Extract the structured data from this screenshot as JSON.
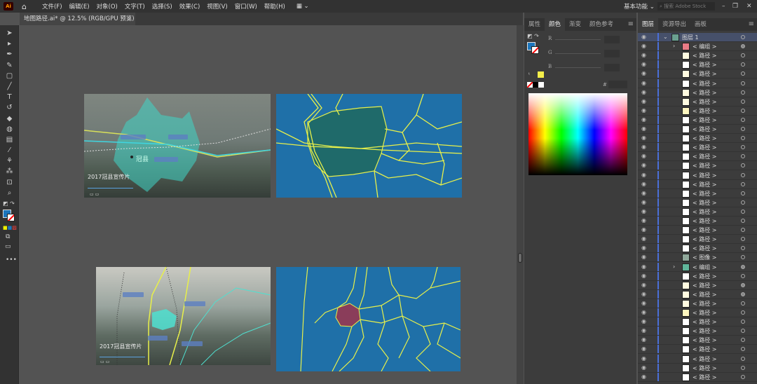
{
  "app": {
    "logo": "Ai",
    "home_icon": "home-icon"
  },
  "menu": [
    "文件(F)",
    "编辑(E)",
    "对象(O)",
    "文字(T)",
    "选择(S)",
    "效果(C)",
    "视图(V)",
    "窗口(W)",
    "帮助(H)"
  ],
  "workspace": {
    "label": "基本功能",
    "search_placeholder": "搜索 Adobe Stock"
  },
  "document_tab": {
    "title": "地图路径.ai* @ 12.5% (RGB/GPU 预览)",
    "close": "×"
  },
  "tools": [
    "selection",
    "direct-selection",
    "pen",
    "curvature",
    "rectangle",
    "paintbrush",
    "type",
    "rotate",
    "eraser",
    "shape-builder",
    "gradient",
    "eyedropper",
    "puppet-warp",
    "symbol-sprayer",
    "artboard",
    "zoom"
  ],
  "artboards": {
    "video1_caption": "2017冠县宣传片",
    "video1_city": "冠县",
    "video2_caption": "2017冠县宣传片",
    "map_colors": {
      "ocean": "#1f70a8",
      "road": "#e8f04a",
      "region1": "#1f6a6a",
      "region2": "#8a3d5a"
    }
  },
  "color_panel": {
    "tabs": [
      "属性",
      "颜色",
      "渐变",
      "颜色参考"
    ],
    "active_tab": "颜色",
    "channels": [
      "R",
      "G",
      "B"
    ],
    "hex_label": "#",
    "fill_color": "#1b75bc",
    "stroke": "none",
    "warning_swatch": "#f4ee4a"
  },
  "layers_panel": {
    "tabs": [
      "图层",
      "资源导出",
      "画板"
    ],
    "active_tab": "图层",
    "layer": {
      "name": "图层 1"
    },
    "items": [
      {
        "name": "< 编组 >",
        "expand": true,
        "thumb": "#e87a86",
        "filled": true
      },
      {
        "name": "< 路径 >",
        "thumb": "#fffbe0"
      },
      {
        "name": "< 路径 >",
        "thumb": "#ffffff"
      },
      {
        "name": "< 路径 >",
        "thumb": "#fffbe0"
      },
      {
        "name": "< 路径 >",
        "thumb": "#ffffff"
      },
      {
        "name": "< 路径 >",
        "thumb": "#fffbe0"
      },
      {
        "name": "< 路径 >",
        "thumb": "#fffbe0"
      },
      {
        "name": "< 路径 >",
        "thumb": "#fff7c0"
      },
      {
        "name": "< 路径 >",
        "thumb": "#ffffff"
      },
      {
        "name": "< 路径 >",
        "thumb": "#ffffff"
      },
      {
        "name": "< 路径 >",
        "thumb": "#ffffff"
      },
      {
        "name": "< 路径 >",
        "thumb": "#ffffff"
      },
      {
        "name": "< 路径 >",
        "thumb": "#ffffff"
      },
      {
        "name": "< 路径 >",
        "thumb": "#ffffff"
      },
      {
        "name": "< 路径 >",
        "thumb": "#ffffff"
      },
      {
        "name": "< 路径 >",
        "thumb": "#ffffff"
      },
      {
        "name": "< 路径 >",
        "thumb": "#ffffff"
      },
      {
        "name": "< 路径 >",
        "thumb": "#ffffff"
      },
      {
        "name": "< 路径 >",
        "thumb": "#ffffff"
      },
      {
        "name": "< 路径 >",
        "thumb": "#ffffff"
      },
      {
        "name": "< 路径 >",
        "thumb": "#ffffff"
      },
      {
        "name": "< 路径 >",
        "thumb": "#ffffff"
      },
      {
        "name": "< 路径 >",
        "thumb": "#ffffff"
      },
      {
        "name": "< 图像 >",
        "thumb": "#8fa79a"
      },
      {
        "name": "< 编组 >",
        "expand": true,
        "thumb": "#5fb59a",
        "filled": true
      },
      {
        "name": "< 路径 >",
        "thumb": "#ffffff"
      },
      {
        "name": "< 路径 >",
        "thumb": "#fffbe0",
        "filled": true
      },
      {
        "name": "< 路径 >",
        "thumb": "#fffbe0",
        "filled": true
      },
      {
        "name": "< 路径 >",
        "thumb": "#fffbe0"
      },
      {
        "name": "< 路径 >",
        "thumb": "#fff7c0"
      },
      {
        "name": "< 路径 >",
        "thumb": "#ffffff"
      },
      {
        "name": "< 路径 >",
        "thumb": "#ffffff"
      },
      {
        "name": "< 路径 >",
        "thumb": "#ffffff"
      },
      {
        "name": "< 路径 >",
        "thumb": "#ffffff"
      },
      {
        "name": "< 路径 >",
        "thumb": "#ffffff"
      },
      {
        "name": "< 路径 >",
        "thumb": "#ffffff"
      },
      {
        "name": "< 路径 >",
        "thumb": "#ffffff"
      }
    ]
  }
}
